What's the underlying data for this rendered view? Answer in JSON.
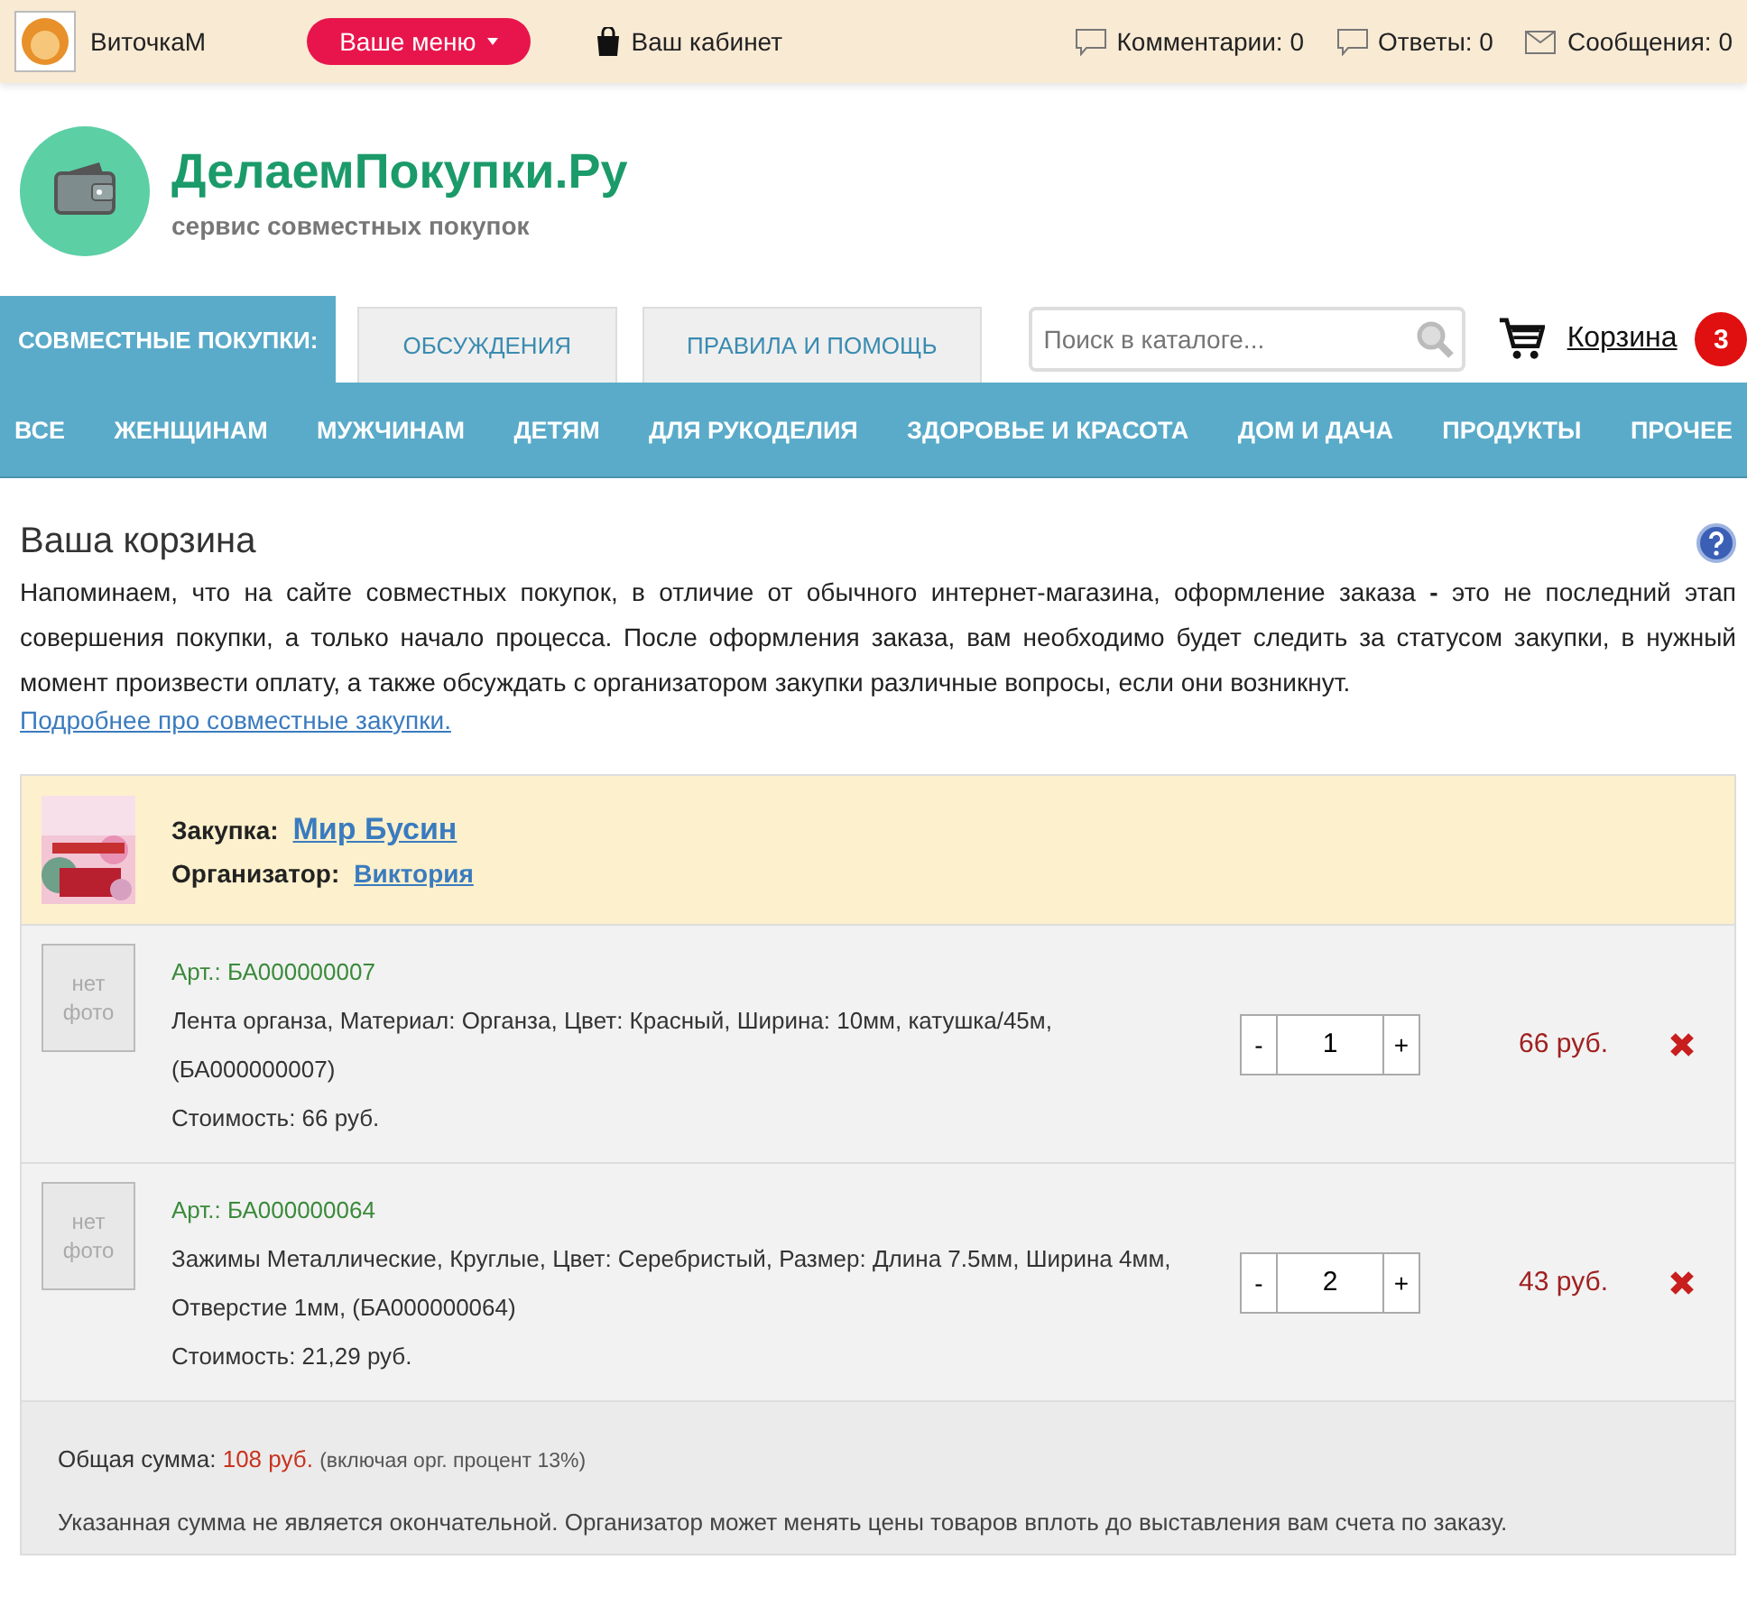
{
  "top_bar": {
    "user_name": "ВиточкаМ",
    "menu_button": "Ваше меню",
    "cabinet_link": "Ваш кабинет",
    "counters": [
      {
        "kind": "comment",
        "label": "Комментарии: 0"
      },
      {
        "kind": "comment",
        "label": "Ответы: 0"
      },
      {
        "kind": "mail",
        "label": "Сообщения: 0"
      }
    ]
  },
  "logo": {
    "title": "ДелаемПокупки.Ру",
    "subtitle": "сервис совместных покупок"
  },
  "tabs": [
    {
      "label": "СОВМЕСТНЫЕ ПОКУПКИ:",
      "selected": true
    },
    {
      "label": "ОБСУЖДЕНИЯ",
      "selected": false
    },
    {
      "label": "ПРАВИЛА И ПОМОЩЬ",
      "selected": false
    }
  ],
  "search": {
    "placeholder": "Поиск в каталоге..."
  },
  "cart": {
    "label": "Корзина",
    "count": "3"
  },
  "categories": [
    "ВСЕ",
    "ЖЕНЩИНАМ",
    "МУЖЧИНАМ",
    "ДЕТЯМ",
    "ДЛЯ РУКОДЕЛИЯ",
    "ЗДОРОВЬЕ И КРАСОТА",
    "ДОМ И ДАЧА",
    "ПРОДУКТЫ",
    "ПРОЧЕЕ"
  ],
  "page": {
    "title": "Ваша корзина",
    "intro": "Напоминаем, что на сайте совместных покупок, в отличие от обычного интернет-магазина, оформление заказа **-** это не последний этап совершения покупки, а только начало процесса. После оформления заказа, вам необходимо будет следить за статусом закупки, в нужный момент произвести оплату, а также обсуждать с организатором закупки различные вопросы, если они возникнут.",
    "more_link": "Подробнее про совместные закупки."
  },
  "purchase": {
    "label": "Закупка:",
    "name": "Мир Бусин",
    "organizer_label": "Организатор:",
    "organizer": "Виктория"
  },
  "items": [
    {
      "photo": "нет фото",
      "article": "Арт.: БА000000007",
      "description": "Лента органза, Материал: Органза, Цвет: Красный, Ширина: 10мм, катушка/45м, (БА000000007)",
      "cost": "Стоимость: 66 руб.",
      "minus": "-",
      "quantity": "1",
      "plus": "+",
      "price": "66 руб."
    },
    {
      "photo": "нет фото",
      "article": "Арт.: БА000000064",
      "description": "Зажимы Металлические, Круглые, Цвет: Серебристый, Размер: Длина 7.5мм, Ширина 4мм, Отверстие 1мм, (БА000000064)",
      "cost": "Стоимость: 21,29 руб.",
      "minus": "-",
      "quantity": "2",
      "plus": "+",
      "price": "43 руб."
    }
  ],
  "summary": {
    "label": "Общая сумма:",
    "amount": "108 руб.",
    "note": "(включая орг. процент 13%)",
    "disclaimer": "Указанная сумма не является окончательной. Организатор может менять цены товаров вплоть до выставления вам счета по заказу."
  }
}
